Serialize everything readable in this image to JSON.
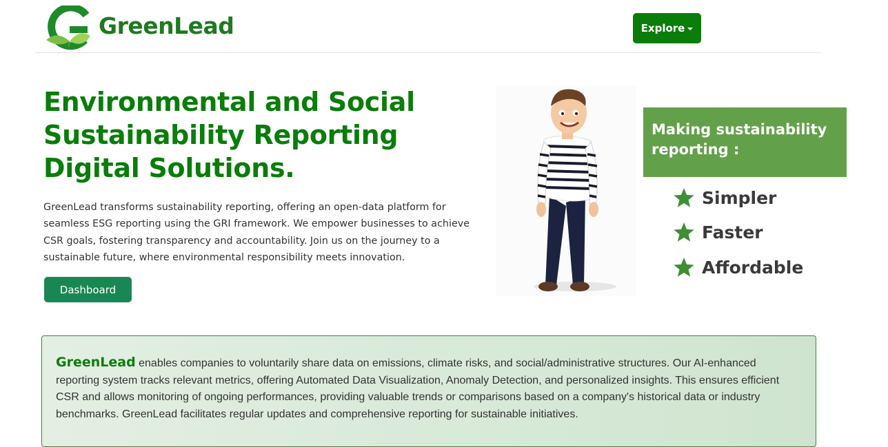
{
  "header": {
    "logo_icon": "greenlead-g-leaf-logo",
    "brand_name": "GreenLead",
    "explore_label": "Explore",
    "explore_caret_icon": "caret-down-icon"
  },
  "hero": {
    "title": "Environmental and Social Sustainability Reporting Digital Solutions.",
    "description": "GreenLead transforms sustainability reporting, offering an open-data platform for seamless ESG reporting using the GRI framework. We empower businesses to achieve CSR goals, fostering transparency and accountability. Join us on the journey to a sustainable future, where environmental responsibility meets innovation.",
    "dashboard_label": "Dashboard",
    "character_image": "cartoon-man-striped-sweater"
  },
  "promo": {
    "heading": "Making sustainability reporting :",
    "benefits": [
      {
        "label": "Simpler",
        "icon": "star-icon"
      },
      {
        "label": "Faster",
        "icon": "star-icon"
      },
      {
        "label": "Affordable",
        "icon": "star-icon"
      }
    ]
  },
  "about": {
    "brand": "GreenLead",
    "text": " enables companies to voluntarily share data on emissions, climate risks, and social/administrative structures. Our AI-enhanced reporting system tracks relevant metrics, offering Automated Data Visualization, Anomaly Detection, and personalized insights. This ensures efficient CSR and allows monitoring of ongoing performances, providing valuable trends or comparisons based on a company's historical data or industry benchmarks. GreenLead facilitates regular updates and comprehensive reporting for sustainable initiatives."
  },
  "colors": {
    "brand_green": "#0a7d0a",
    "dashboard_green": "#198754",
    "promo_green": "#63a04a",
    "star_green": "#3f8f35"
  }
}
